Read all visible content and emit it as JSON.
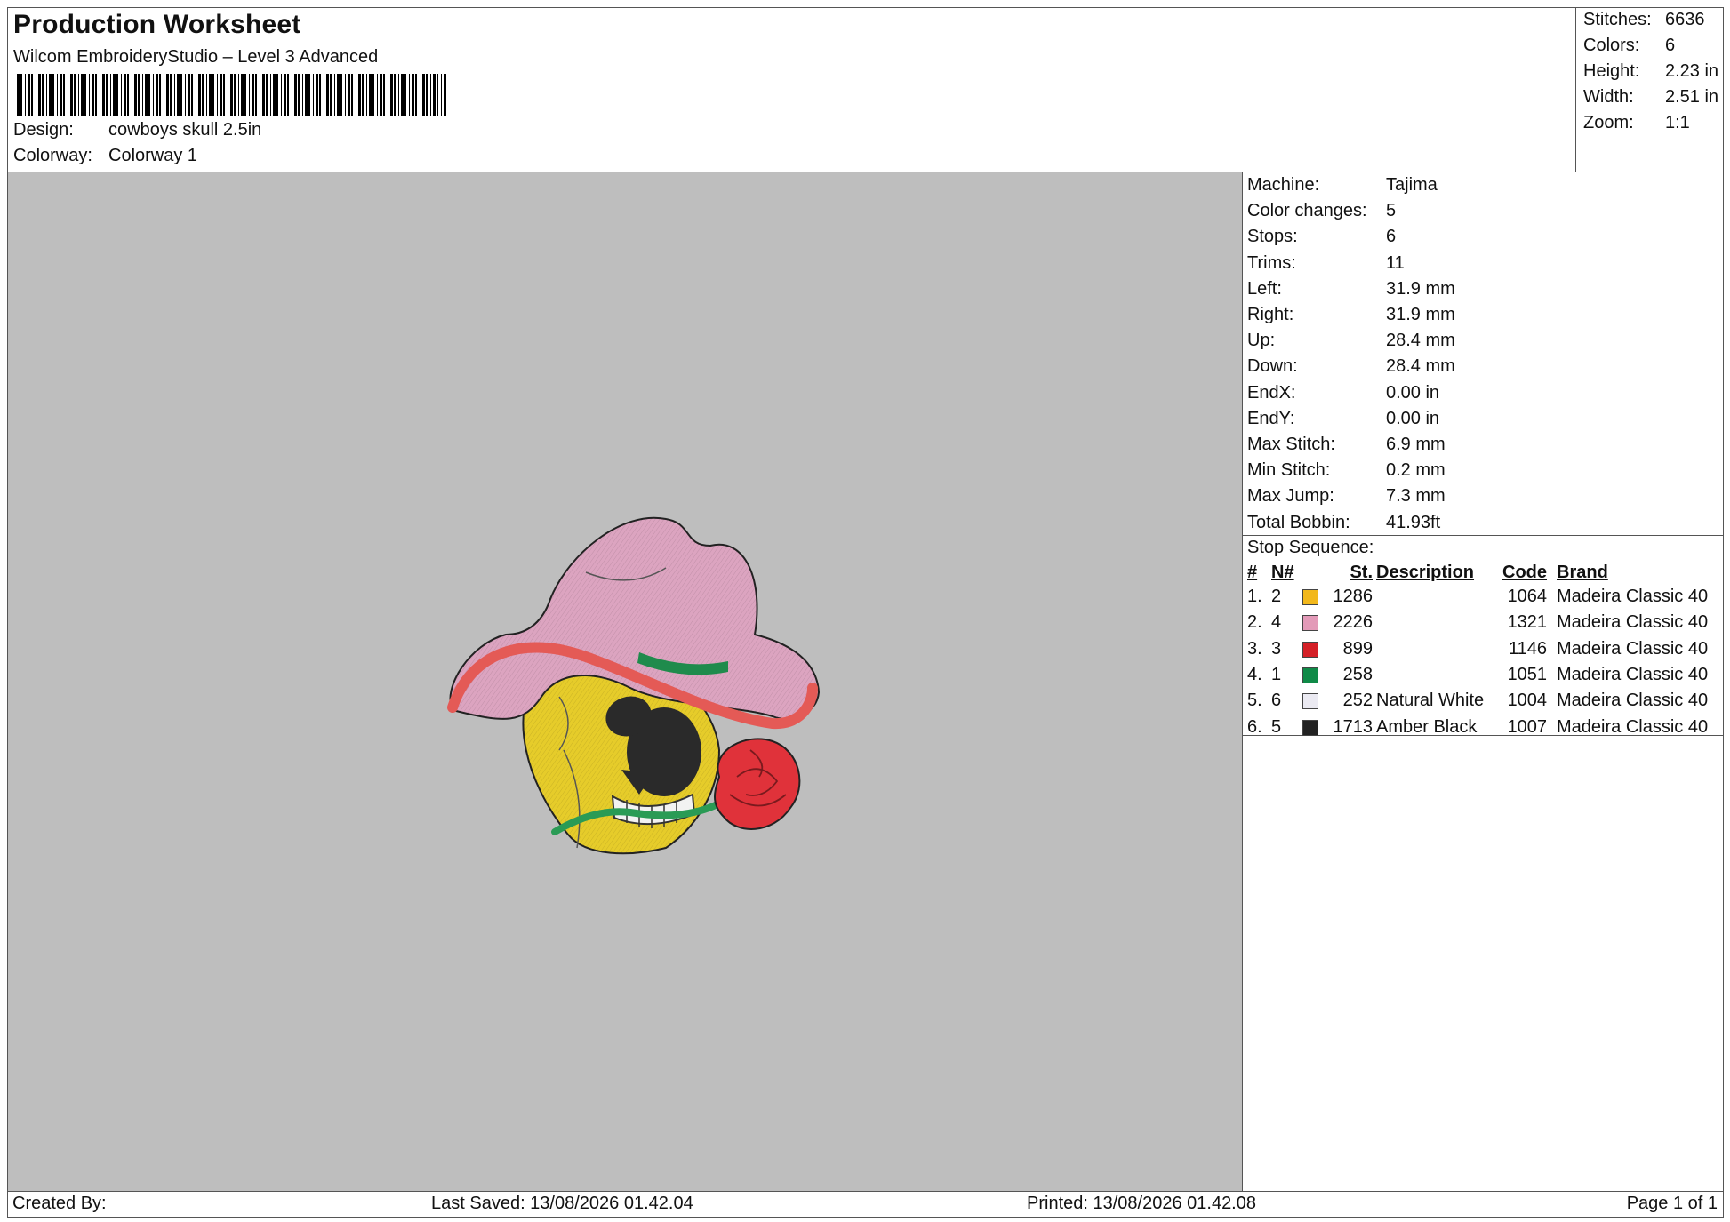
{
  "header": {
    "title": "Production Worksheet",
    "subtitle": "Wilcom EmbroideryStudio – Level 3 Advanced",
    "design_label": "Design:",
    "design_value": "cowboys skull 2.5in",
    "colorway_label": "Colorway:",
    "colorway_value": "Colorway 1"
  },
  "stats": [
    {
      "label": "Stitches:",
      "value": "6636"
    },
    {
      "label": "Colors:",
      "value": "6"
    },
    {
      "label": "Height:",
      "value": "2.23 in"
    },
    {
      "label": "Width:",
      "value": "2.51 in"
    },
    {
      "label": "Zoom:",
      "value": "1:1"
    }
  ],
  "machine_info": [
    {
      "label": "Machine:",
      "value": "Tajima"
    },
    {
      "label": "Color changes:",
      "value": "5"
    },
    {
      "label": "Stops:",
      "value": "6"
    },
    {
      "label": "Trims:",
      "value": "11"
    },
    {
      "label": "Left:",
      "value": "31.9 mm"
    },
    {
      "label": "Right:",
      "value": "31.9 mm"
    },
    {
      "label": "Up:",
      "value": "28.4 mm"
    },
    {
      "label": "Down:",
      "value": "28.4 mm"
    },
    {
      "label": "EndX:",
      "value": "0.00 in"
    },
    {
      "label": "EndY:",
      "value": "0.00 in"
    },
    {
      "label": "Max Stitch:",
      "value": "6.9 mm"
    },
    {
      "label": "Min Stitch:",
      "value": "0.2 mm"
    },
    {
      "label": "Max Jump:",
      "value": "7.3 mm"
    },
    {
      "label": "Total Bobbin:",
      "value": "41.93ft"
    }
  ],
  "stop_sequence": {
    "title": "Stop Sequence:",
    "headers": {
      "num": "#",
      "n_num": "N#",
      "st": "St.",
      "description": "Description",
      "code": "Code",
      "brand": "Brand"
    },
    "rows": [
      {
        "num": "1.",
        "n": "2",
        "color": "#f2b81c",
        "st": "1286",
        "description": "",
        "code": "1064",
        "brand": "Madeira Classic 40"
      },
      {
        "num": "2.",
        "n": "4",
        "color": "#e39ab8",
        "st": "2226",
        "description": "",
        "code": "1321",
        "brand": "Madeira Classic 40"
      },
      {
        "num": "3.",
        "n": "3",
        "color": "#d42027",
        "st": "899",
        "description": "",
        "code": "1146",
        "brand": "Madeira Classic 40"
      },
      {
        "num": "4.",
        "n": "1",
        "color": "#0f8a47",
        "st": "258",
        "description": "",
        "code": "1051",
        "brand": "Madeira Classic 40"
      },
      {
        "num": "5.",
        "n": "6",
        "color": "#ebeaf2",
        "st": "252",
        "description": "Natural White",
        "code": "1004",
        "brand": "Madeira Classic 40"
      },
      {
        "num": "6.",
        "n": "5",
        "color": "#222222",
        "st": "1713",
        "description": "Amber Black",
        "code": "1007",
        "brand": "Madeira Classic 40"
      }
    ]
  },
  "footer": {
    "created_by": "Created By:",
    "last_saved": "Last Saved: 13/08/2026 01.42.04",
    "printed": "Printed: 13/08/2026 01.42.08",
    "page": "Page 1 of 1"
  }
}
